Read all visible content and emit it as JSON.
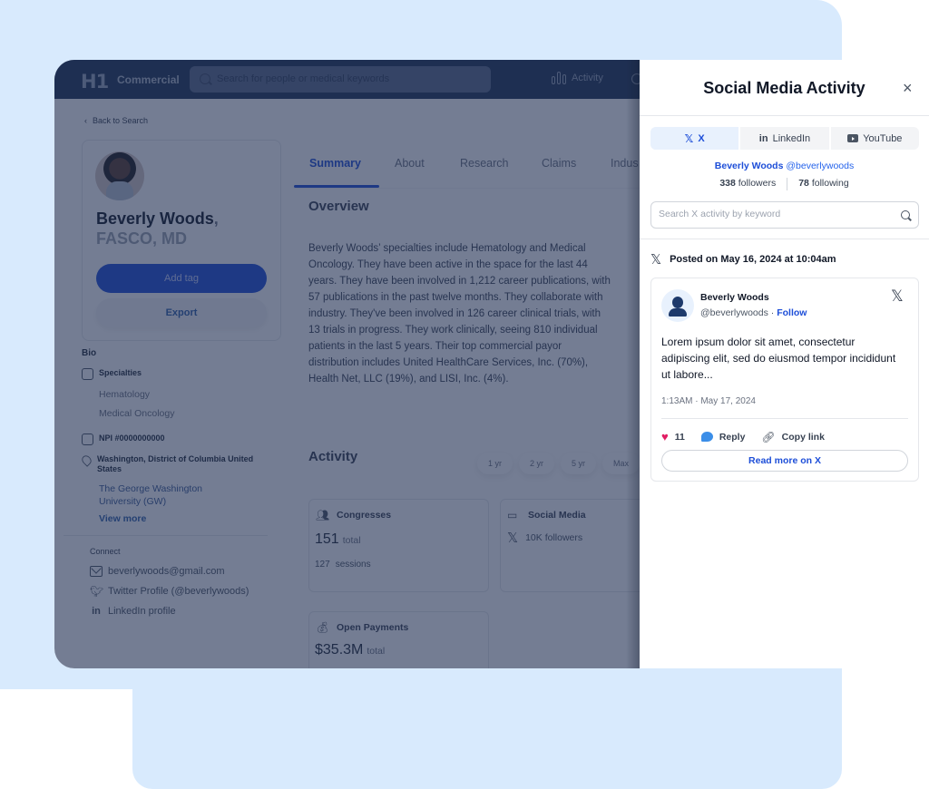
{
  "app": {
    "brand": "H1",
    "product": "Commercial",
    "search_placeholder": "Search for people or medical keywords",
    "nav_activity": "Activity",
    "back_link": "Back to Search"
  },
  "profile": {
    "name": "Beverly Woods",
    "name_suffix": ",",
    "credentials": "FASCO, MD",
    "add_tag": "Add tag",
    "export": "Export"
  },
  "bio": {
    "title": "Bio",
    "specialties_label": "Specialties",
    "specialties": [
      "Hematology",
      "Medical Oncology"
    ],
    "npi": "NPI #0000000000",
    "location": "Washington, District of Columbia United States",
    "institution": "The George Washington University (GW)",
    "view_more": "View more"
  },
  "connect": {
    "title": "Connect",
    "items": [
      {
        "icon": "mail-icon",
        "label": "beverlywoods@gmail.com"
      },
      {
        "icon": "twitter-icon",
        "label": "Twitter Profile (@beverlywoods)"
      },
      {
        "icon": "linkedin-icon",
        "label": "LinkedIn profile"
      }
    ]
  },
  "tabs": [
    {
      "label": "Summary",
      "active": true
    },
    {
      "label": "About"
    },
    {
      "label": "Research"
    },
    {
      "label": "Claims"
    },
    {
      "label": "Indus"
    }
  ],
  "overview": {
    "title": "Overview",
    "text": "Beverly Woods’ specialties include Hematology and Medical Oncology. They have been active in the space for the last 44 years. They have been involved in 1,212 career publications, with 57 publications in the past twelve months. They collaborate with industry. They've been involved in 126 career clinical trials, with 13 trials in progress. They work clinically, seeing 810 individual patients in the last 5 years. Their top commercial payor distribution includes United HealthCare Services, Inc. (70%), Health Net, LLC (19%), and LISI, Inc. (4%)."
  },
  "activity": {
    "title": "Activity",
    "ranges": [
      "1 yr",
      "2 yr",
      "5 yr",
      "Max"
    ],
    "congresses": {
      "title": "Congresses",
      "total": "151",
      "total_label": "total",
      "sessions": "127",
      "sessions_label": "sessions"
    },
    "social": {
      "title": "Social Media",
      "followers": "10K followers"
    },
    "payments": {
      "title": "Open Payments",
      "total": "$35.3M",
      "total_label": "total"
    }
  },
  "drawer": {
    "title": "Social Media Activity",
    "close": "×",
    "tabs": [
      {
        "label": "X",
        "icon": "x-logo-icon",
        "active": true
      },
      {
        "label": "LinkedIn",
        "icon": "linkedin-icon"
      },
      {
        "label": "YouTube",
        "icon": "youtube-icon"
      }
    ],
    "account_name": "Beverly Woods",
    "account_handle": "@beverlywoods",
    "followers_count": "338",
    "followers_label": "followers",
    "following_count": "78",
    "following_label": "following",
    "search_placeholder": "Search X activity by keyword",
    "posted_on": "Posted on May 16, 2024 at 10:04am",
    "tweet": {
      "author": "Beverly Woods",
      "handle": "@beverlywoods",
      "follow": "Follow",
      "body": "Lorem ipsum dolor sit amet, consectetur adipiscing elit, sed do eiusmod tempor incididunt ut labore...",
      "timestamp": "1:13AM · May 17, 2024",
      "likes": "11",
      "reply": "Reply",
      "copy_link": "Copy link",
      "read_more": "Read more on X"
    }
  }
}
